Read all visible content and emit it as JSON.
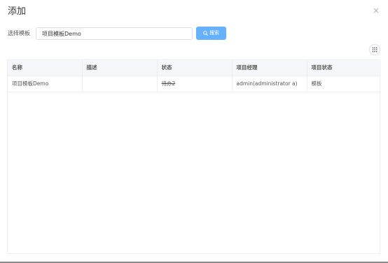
{
  "dialog": {
    "title": "添加",
    "close_glyph": "×"
  },
  "form": {
    "template_label": "选择模板",
    "template_value": "项目模板Demo",
    "search_label": "搜索"
  },
  "table": {
    "columns": [
      "名称",
      "描述",
      "状态",
      "项目经理",
      "项目状态"
    ],
    "rows": [
      {
        "name": "项目模板Demo",
        "description": "",
        "status": "待办2",
        "manager": "admin(administrator a)",
        "project_status": "模板"
      }
    ]
  },
  "colors": {
    "primary_button": "#66b1ff",
    "header_bg": "#f5f7fa",
    "border": "#ebeef5"
  },
  "icons": {
    "search_button_icon": "search-icon",
    "columns_button_icon": "grid-dots-icon",
    "close_icon": "close-icon"
  }
}
